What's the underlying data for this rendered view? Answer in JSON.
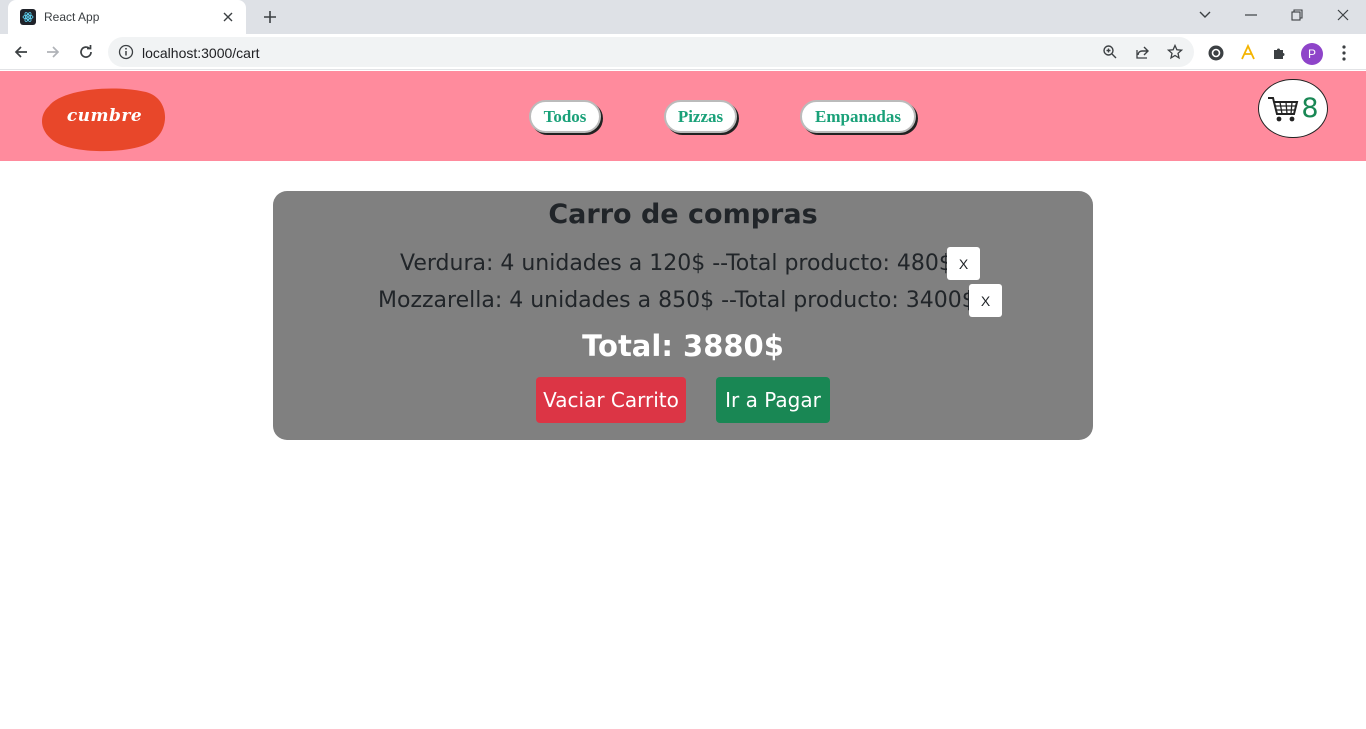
{
  "browser": {
    "tab_title": "React App",
    "url": "localhost:3000/cart",
    "profile_initial": "P"
  },
  "site": {
    "logo_text": "cumbre",
    "nav": [
      {
        "label": "Todos"
      },
      {
        "label": "Pizzas"
      },
      {
        "label": "Empanadas"
      }
    ],
    "cart_count": "8"
  },
  "cart": {
    "title": "Carro de compras",
    "items": [
      {
        "text": "Verdura: 4 unidades a 120$ --Total producto: 480$",
        "remove_label": "X"
      },
      {
        "text": "Mozzarella: 4 unidades a 850$ --Total producto: 3400$",
        "remove_label": "X"
      }
    ],
    "total": "Total: 3880$",
    "clear_button": "Vaciar Carrito",
    "pay_button": "Ir a Pagar"
  },
  "colors": {
    "header_bg": "#ff8b9d",
    "logo_bg": "#e8472a",
    "nav_text": "#1aa179",
    "cart_box_bg": "#808080",
    "danger": "#dc3545",
    "success": "#198754"
  }
}
